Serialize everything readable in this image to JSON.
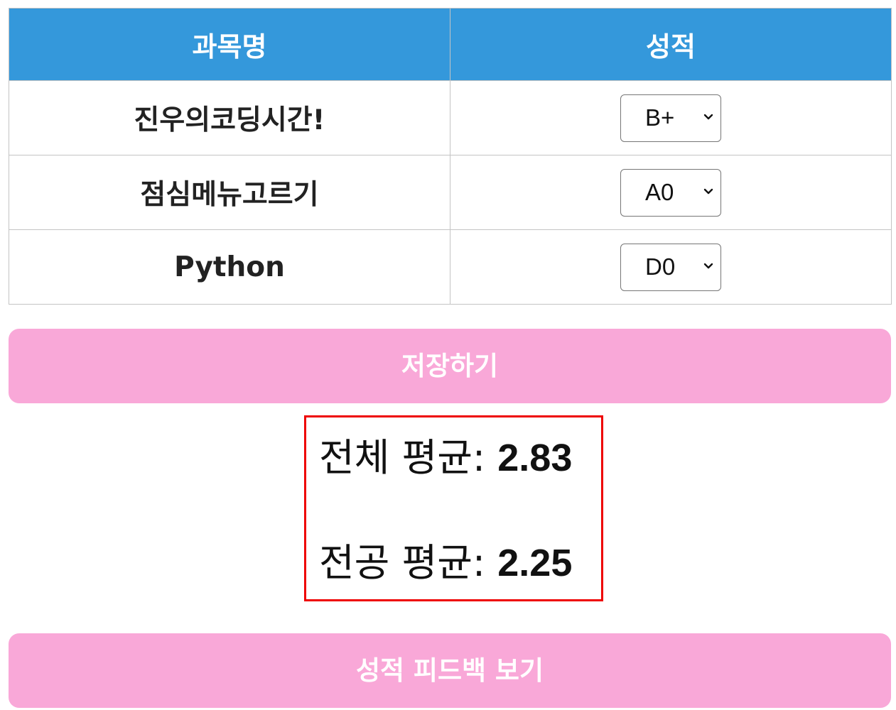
{
  "table": {
    "headers": {
      "subject": "과목명",
      "grade": "성적"
    },
    "rows": [
      {
        "subject": "진우의코딩시간!",
        "grade": "B+"
      },
      {
        "subject": "점심메뉴고르기",
        "grade": "A0"
      },
      {
        "subject": "Python",
        "grade": "D0"
      }
    ]
  },
  "buttons": {
    "save": "저장하기",
    "feedback": "성적 피드백 보기"
  },
  "averages": {
    "total_label": "전체 평균: ",
    "total_value": "2.83",
    "major_label": "전공 평균: ",
    "major_value": "2.25"
  },
  "colors": {
    "header_bg": "#3498db",
    "button_bg": "#f9a8d8",
    "highlight_border": "#ee0000"
  },
  "icons": {
    "dropdown": "chevron-down-icon"
  }
}
